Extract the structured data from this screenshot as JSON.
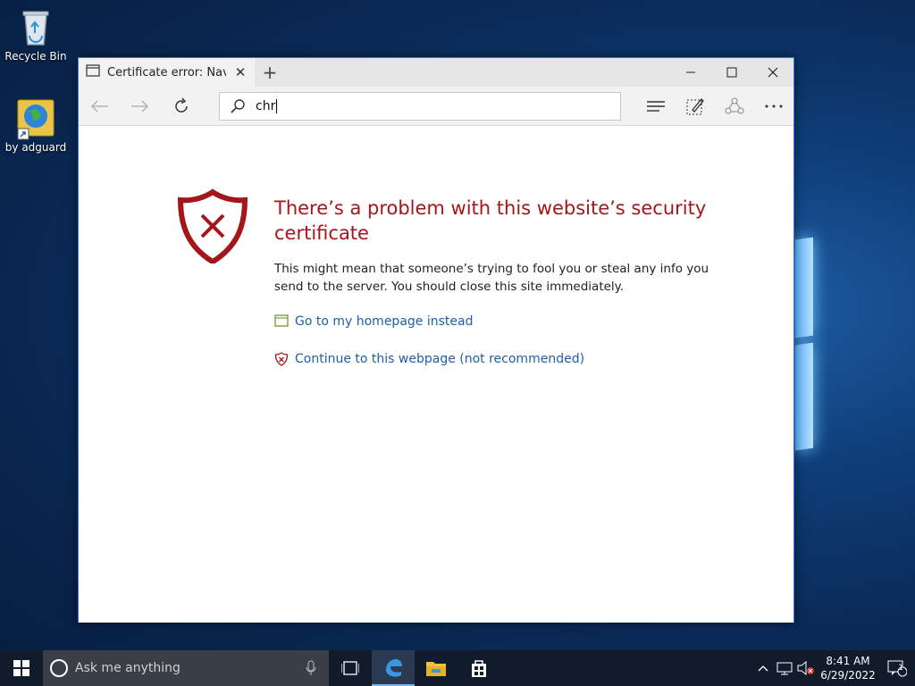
{
  "desktop": {
    "icons": [
      {
        "label": "Recycle Bin",
        "icon": "recycle-bin-icon"
      },
      {
        "label": "by adguard",
        "icon": "globe-shortcut-icon"
      }
    ]
  },
  "browser": {
    "tab": {
      "title": "Certificate error: Naviga",
      "icon": "tab-page-icon"
    },
    "window_controls": {
      "minimize": "minimize-icon",
      "maximize": "maximize-icon",
      "close": "close-icon"
    },
    "address_bar": {
      "value": "chr",
      "icon": "search-icon"
    },
    "toolbar_icons": [
      "hub-icon",
      "web-note-icon",
      "share-icon",
      "more-icon"
    ],
    "error_page": {
      "title": "There’s a problem with this website’s security certificate",
      "description": "This might mean that someone’s trying to fool you or steal any info you send to the server. You should close this site immediately.",
      "homepage_link": "Go to my homepage instead",
      "continue_link": "Continue to this webpage (not recommended)",
      "accent_color": "#a4161a",
      "link_color": "#1f5fa8"
    }
  },
  "taskbar": {
    "search_placeholder": "Ask me anything",
    "apps": [
      "task-view-icon",
      "edge-icon",
      "file-explorer-icon",
      "store-icon"
    ],
    "active_app": "edge-icon",
    "clock": {
      "time": "8:41 AM",
      "date": "6/29/2022"
    },
    "notification_count": "1"
  }
}
